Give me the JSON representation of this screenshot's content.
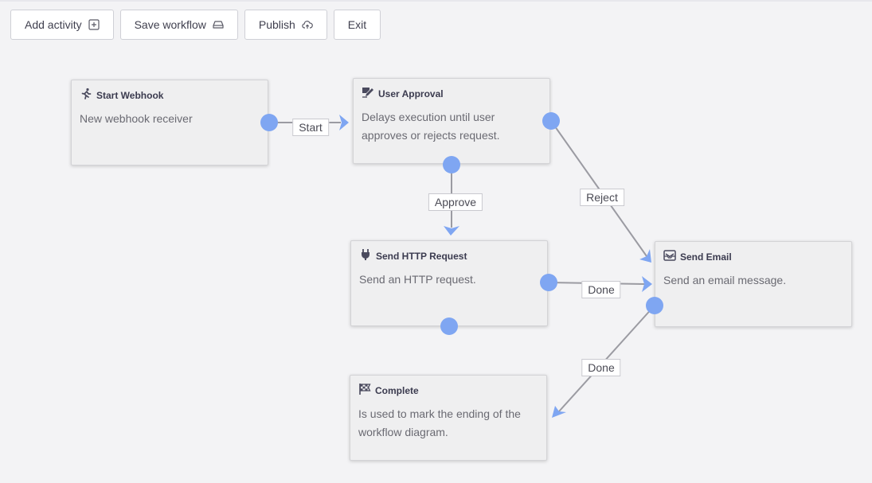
{
  "toolbar": {
    "add_activity": "Add activity",
    "save_workflow": "Save workflow",
    "publish": "Publish",
    "exit": "Exit"
  },
  "colors": {
    "port": "#7fa6f2",
    "edge": "#9b9ba2",
    "arrow": "#7fa6f2"
  },
  "nodes": {
    "start_webhook": {
      "title": "Start Webhook",
      "description": "New webhook receiver",
      "icon": "running-icon"
    },
    "user_approval": {
      "title": "User Approval",
      "description": "Delays execution until user approves or rejects request.",
      "icon": "signature-icon"
    },
    "send_http": {
      "title": "Send HTTP Request",
      "description": "Send an HTTP request.",
      "icon": "plug-icon"
    },
    "send_email": {
      "title": "Send Email",
      "description": "Send an email message.",
      "icon": "envelope-icon"
    },
    "complete": {
      "title": "Complete",
      "description": "Is used to mark the ending of the workflow diagram.",
      "icon": "flag-checkered-icon"
    }
  },
  "edges": {
    "start": "Start",
    "approve": "Approve",
    "reject": "Reject",
    "done_http": "Done",
    "done_email": "Done"
  }
}
